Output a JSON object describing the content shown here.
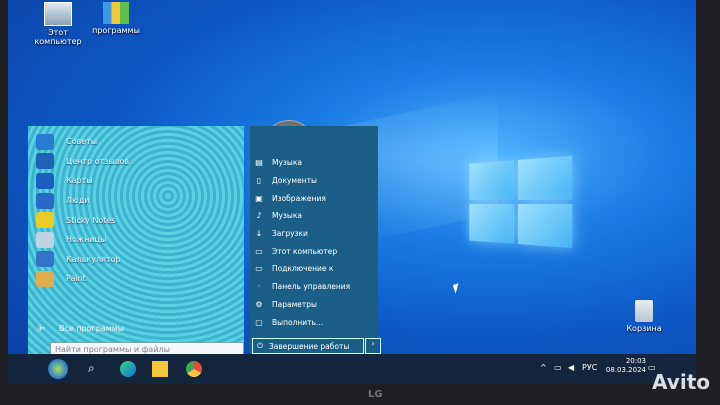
{
  "desktop": {
    "icons": [
      {
        "label": "Этот\nкомпьютер",
        "icon": "computer-icon"
      },
      {
        "label": "программы",
        "icon": "folder-programs-icon"
      },
      {
        "label": "Корзина",
        "icon": "recycle-bin-icon"
      }
    ]
  },
  "start_menu": {
    "apps": [
      {
        "label": "Советы",
        "icon": "tips-icon",
        "color": "#2a7fd4"
      },
      {
        "label": "Центр отзывов",
        "icon": "feedback-icon",
        "color": "#1f64b8"
      },
      {
        "label": "Карты",
        "icon": "maps-icon",
        "color": "#1b5fc1"
      },
      {
        "label": "Люди",
        "icon": "people-icon",
        "color": "#2d6ac9"
      },
      {
        "label": "Sticky Notes",
        "icon": "sticky-notes-icon",
        "color": "#f3d21c"
      },
      {
        "label": "Ножницы",
        "icon": "scissors-icon",
        "color": "#c8d8e8"
      },
      {
        "label": "Калькулятор",
        "icon": "calculator-icon",
        "color": "#3576c8"
      },
      {
        "label": "Paint",
        "icon": "paint-icon",
        "color": "#e9b14a"
      }
    ],
    "all_programs": "Все программы",
    "search_placeholder": "Найти программы и файлы",
    "places": [
      {
        "label": "Музыка",
        "icon": "music-folder-icon"
      },
      {
        "label": "Документы",
        "icon": "documents-icon"
      },
      {
        "label": "Изображения",
        "icon": "pictures-icon"
      },
      {
        "label": "Музыка",
        "icon": "music-icon"
      },
      {
        "label": "Загрузки",
        "icon": "downloads-icon"
      },
      {
        "label": "Этот компьютер",
        "icon": "computer-icon"
      },
      {
        "label": "Подключение к",
        "icon": "connect-icon"
      },
      {
        "label": "Панель управления",
        "icon": "control-panel-icon"
      },
      {
        "label": "Параметры",
        "icon": "settings-icon"
      },
      {
        "label": "Выполнить...",
        "icon": "run-icon"
      }
    ],
    "shutdown": "Завершение работы"
  },
  "taskbar": {
    "time": "20:03",
    "date": "08.03.2024",
    "lang": "РУС"
  },
  "monitor_brand": "LG",
  "watermark": "Avito"
}
